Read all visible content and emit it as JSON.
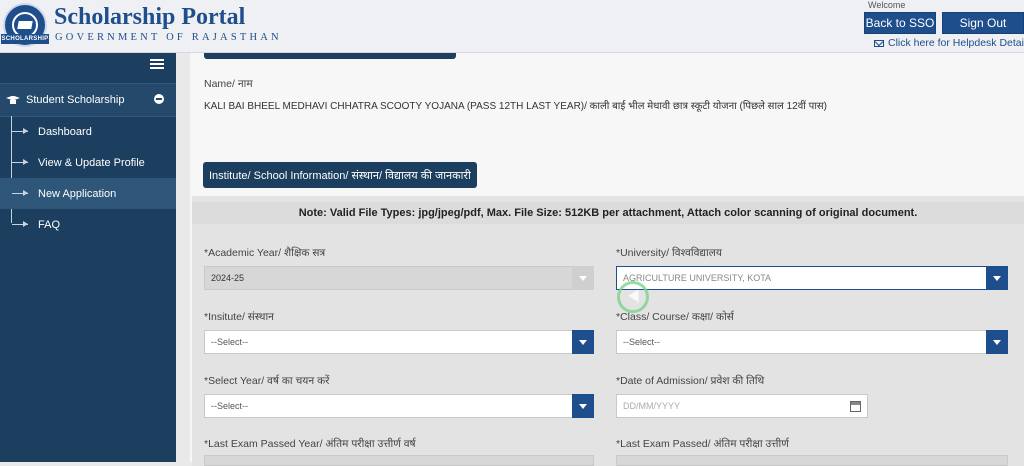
{
  "header": {
    "brand_title": "Scholarship Portal",
    "brand_subtitle": "GOVERNMENT OF RAJASTHAN",
    "seal_text": "SCHOLARSHIP",
    "welcome": "Welcome",
    "back_to_sso": "Back to SSO",
    "sign_out": "Sign Out",
    "helpdesk": "Click here for Helpdesk Details"
  },
  "sidebar": {
    "section": "Student Scholarship",
    "items": [
      {
        "label": "Dashboard"
      },
      {
        "label": "View & Update Profile"
      },
      {
        "label": "New Application"
      },
      {
        "label": "FAQ"
      }
    ]
  },
  "content": {
    "name_label": "Name/ नाम",
    "name_value": "KALI BAI BHEEL MEDHAVI CHHATRA SCOOTY YOJANA (PASS 12TH LAST YEAR)/ काली बाई भील मेधावी छात्र स्कूटी योजना (पिछले साल 12वीं पास)",
    "section_heading": "Institute/ School Information/ संस्थान/ विद्यालय की जानकारी",
    "note": "Note: Valid File Types: jpg/jpeg/pdf, Max. File Size: 512KB per attachment, Attach color scanning of original document.",
    "fields": {
      "academic_year_label": "*Academic Year/ शैक्षिक सत्र",
      "academic_year_value": "2024-25",
      "university_label": "*University/ विश्वविद्यालय",
      "university_value": "AGRICULTURE UNIVERSITY, KOTA",
      "institute_label": "*Insitute/ संस्थान",
      "institute_value": "--Select--",
      "class_label": "*Class/ Course/ कक्षा/ कोर्स",
      "class_value": "--Select--",
      "select_year_label": "*Select Year/ वर्ष का चयन करें",
      "select_year_value": "--Select--",
      "admission_label": "*Date of Admission/ प्रवेश की तिथि",
      "admission_placeholder": "DD/MM/YYYY",
      "last_exam_year_label": "*Last Exam Passed Year/ अंतिम परीक्षा उत्तीर्ण वर्ष",
      "last_exam_label": "*Last Exam Passed/ अंतिम परीक्षा उत्तीर्ण"
    }
  },
  "colors": {
    "brand": "#1f4e8c",
    "sidebar": "#1c3f5f",
    "active_item": "#2d5678"
  }
}
